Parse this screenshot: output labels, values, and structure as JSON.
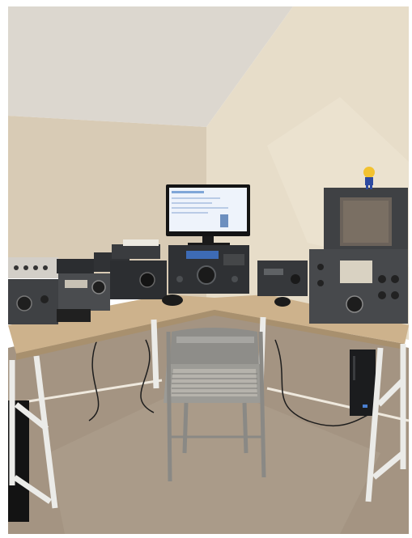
{
  "photo": {
    "subject": "",
    "palette": {
      "wall_left": "#d9cdb8",
      "wall_right": "#e6dcc8",
      "ceiling": "#dcd6cc",
      "carpet": "#a59583",
      "desk_top": "#cdb28d",
      "desk_frame": "#e9e9e6",
      "radio_dark": "#3d3f42",
      "radio_panel": "#56595c",
      "monitor_glow": "#eef3fb",
      "chair": "#8d8c88"
    }
  }
}
